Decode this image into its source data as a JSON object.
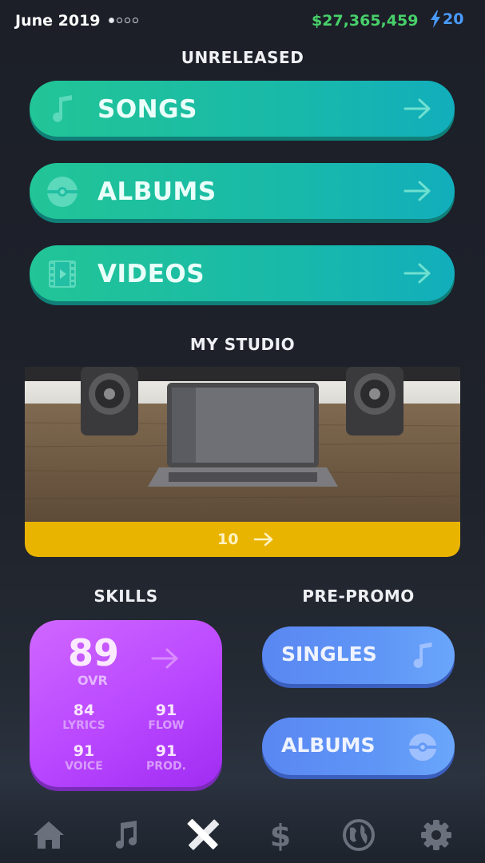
{
  "header": {
    "date": "June 2019",
    "week_dots": [
      true,
      false,
      false,
      false
    ],
    "money": "$27,365,459",
    "energy": "20"
  },
  "unreleased": {
    "title": "UNRELEASED",
    "buttons": [
      {
        "label": "SONGS",
        "icon": "music-note-icon"
      },
      {
        "label": "ALBUMS",
        "icon": "vinyl-disc-icon"
      },
      {
        "label": "VIDEOS",
        "icon": "film-strip-icon"
      }
    ]
  },
  "studio": {
    "title": "MY STUDIO",
    "level": "10"
  },
  "skills": {
    "title": "SKILLS",
    "overall_value": "89",
    "overall_label": "OVR",
    "stats": [
      {
        "value": "84",
        "label": "LYRICS"
      },
      {
        "value": "91",
        "label": "FLOW"
      },
      {
        "value": "91",
        "label": "VOICE"
      },
      {
        "value": "91",
        "label": "PROD."
      }
    ]
  },
  "prepromo": {
    "title": "PRE-PROMO",
    "buttons": [
      {
        "label": "SINGLES",
        "icon": "music-note-icon"
      },
      {
        "label": "ALBUMS",
        "icon": "vinyl-disc-icon"
      }
    ]
  },
  "nav": {
    "items": [
      "home-icon",
      "music-note-icon",
      "pencil-ruler-icon",
      "dollar-icon",
      "globe-icon",
      "gear-icon"
    ],
    "active": "pencil-ruler-icon"
  },
  "colors": {
    "money": "#48d06a",
    "energy": "#4a9bff",
    "unreleased_button": "#1fbf9f",
    "studio_bar": "#e9b400",
    "skills_card": "#b947ff",
    "prepromo_button": "#5f96f6"
  }
}
